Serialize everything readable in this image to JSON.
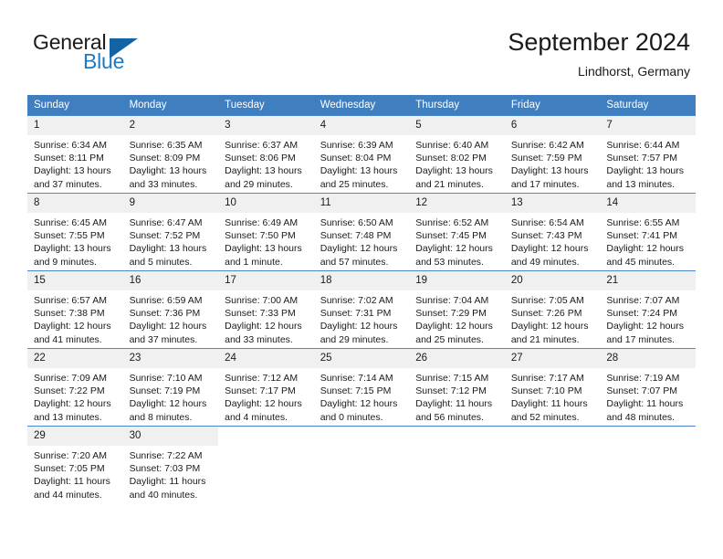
{
  "brand": {
    "name_part1": "General",
    "name_part2": "Blue",
    "triangle_color": "#1464a5",
    "blue_color": "#1f7ac4"
  },
  "header": {
    "title": "September 2024",
    "location": "Lindhorst, Germany",
    "header_bg": "#3f7fbf",
    "header_text_color": "#ffffff",
    "daynum_bg": "#f0f0f0",
    "row_border_color": "#4a86c8"
  },
  "weekdays": [
    {
      "label": "Sunday"
    },
    {
      "label": "Monday"
    },
    {
      "label": "Tuesday"
    },
    {
      "label": "Wednesday"
    },
    {
      "label": "Thursday"
    },
    {
      "label": "Friday"
    },
    {
      "label": "Saturday"
    }
  ],
  "weeks": [
    {
      "days": [
        {
          "num": "1",
          "sunrise": "Sunrise: 6:34 AM",
          "sunset": "Sunset: 8:11 PM",
          "daylight": "Daylight: 13 hours and 37 minutes."
        },
        {
          "num": "2",
          "sunrise": "Sunrise: 6:35 AM",
          "sunset": "Sunset: 8:09 PM",
          "daylight": "Daylight: 13 hours and 33 minutes."
        },
        {
          "num": "3",
          "sunrise": "Sunrise: 6:37 AM",
          "sunset": "Sunset: 8:06 PM",
          "daylight": "Daylight: 13 hours and 29 minutes."
        },
        {
          "num": "4",
          "sunrise": "Sunrise: 6:39 AM",
          "sunset": "Sunset: 8:04 PM",
          "daylight": "Daylight: 13 hours and 25 minutes."
        },
        {
          "num": "5",
          "sunrise": "Sunrise: 6:40 AM",
          "sunset": "Sunset: 8:02 PM",
          "daylight": "Daylight: 13 hours and 21 minutes."
        },
        {
          "num": "6",
          "sunrise": "Sunrise: 6:42 AM",
          "sunset": "Sunset: 7:59 PM",
          "daylight": "Daylight: 13 hours and 17 minutes."
        },
        {
          "num": "7",
          "sunrise": "Sunrise: 6:44 AM",
          "sunset": "Sunset: 7:57 PM",
          "daylight": "Daylight: 13 hours and 13 minutes."
        }
      ]
    },
    {
      "days": [
        {
          "num": "8",
          "sunrise": "Sunrise: 6:45 AM",
          "sunset": "Sunset: 7:55 PM",
          "daylight": "Daylight: 13 hours and 9 minutes."
        },
        {
          "num": "9",
          "sunrise": "Sunrise: 6:47 AM",
          "sunset": "Sunset: 7:52 PM",
          "daylight": "Daylight: 13 hours and 5 minutes."
        },
        {
          "num": "10",
          "sunrise": "Sunrise: 6:49 AM",
          "sunset": "Sunset: 7:50 PM",
          "daylight": "Daylight: 13 hours and 1 minute."
        },
        {
          "num": "11",
          "sunrise": "Sunrise: 6:50 AM",
          "sunset": "Sunset: 7:48 PM",
          "daylight": "Daylight: 12 hours and 57 minutes."
        },
        {
          "num": "12",
          "sunrise": "Sunrise: 6:52 AM",
          "sunset": "Sunset: 7:45 PM",
          "daylight": "Daylight: 12 hours and 53 minutes."
        },
        {
          "num": "13",
          "sunrise": "Sunrise: 6:54 AM",
          "sunset": "Sunset: 7:43 PM",
          "daylight": "Daylight: 12 hours and 49 minutes."
        },
        {
          "num": "14",
          "sunrise": "Sunrise: 6:55 AM",
          "sunset": "Sunset: 7:41 PM",
          "daylight": "Daylight: 12 hours and 45 minutes."
        }
      ]
    },
    {
      "days": [
        {
          "num": "15",
          "sunrise": "Sunrise: 6:57 AM",
          "sunset": "Sunset: 7:38 PM",
          "daylight": "Daylight: 12 hours and 41 minutes."
        },
        {
          "num": "16",
          "sunrise": "Sunrise: 6:59 AM",
          "sunset": "Sunset: 7:36 PM",
          "daylight": "Daylight: 12 hours and 37 minutes."
        },
        {
          "num": "17",
          "sunrise": "Sunrise: 7:00 AM",
          "sunset": "Sunset: 7:33 PM",
          "daylight": "Daylight: 12 hours and 33 minutes."
        },
        {
          "num": "18",
          "sunrise": "Sunrise: 7:02 AM",
          "sunset": "Sunset: 7:31 PM",
          "daylight": "Daylight: 12 hours and 29 minutes."
        },
        {
          "num": "19",
          "sunrise": "Sunrise: 7:04 AM",
          "sunset": "Sunset: 7:29 PM",
          "daylight": "Daylight: 12 hours and 25 minutes."
        },
        {
          "num": "20",
          "sunrise": "Sunrise: 7:05 AM",
          "sunset": "Sunset: 7:26 PM",
          "daylight": "Daylight: 12 hours and 21 minutes."
        },
        {
          "num": "21",
          "sunrise": "Sunrise: 7:07 AM",
          "sunset": "Sunset: 7:24 PM",
          "daylight": "Daylight: 12 hours and 17 minutes."
        }
      ]
    },
    {
      "days": [
        {
          "num": "22",
          "sunrise": "Sunrise: 7:09 AM",
          "sunset": "Sunset: 7:22 PM",
          "daylight": "Daylight: 12 hours and 13 minutes."
        },
        {
          "num": "23",
          "sunrise": "Sunrise: 7:10 AM",
          "sunset": "Sunset: 7:19 PM",
          "daylight": "Daylight: 12 hours and 8 minutes."
        },
        {
          "num": "24",
          "sunrise": "Sunrise: 7:12 AM",
          "sunset": "Sunset: 7:17 PM",
          "daylight": "Daylight: 12 hours and 4 minutes."
        },
        {
          "num": "25",
          "sunrise": "Sunrise: 7:14 AM",
          "sunset": "Sunset: 7:15 PM",
          "daylight": "Daylight: 12 hours and 0 minutes."
        },
        {
          "num": "26",
          "sunrise": "Sunrise: 7:15 AM",
          "sunset": "Sunset: 7:12 PM",
          "daylight": "Daylight: 11 hours and 56 minutes."
        },
        {
          "num": "27",
          "sunrise": "Sunrise: 7:17 AM",
          "sunset": "Sunset: 7:10 PM",
          "daylight": "Daylight: 11 hours and 52 minutes."
        },
        {
          "num": "28",
          "sunrise": "Sunrise: 7:19 AM",
          "sunset": "Sunset: 7:07 PM",
          "daylight": "Daylight: 11 hours and 48 minutes."
        }
      ]
    },
    {
      "days": [
        {
          "num": "29",
          "sunrise": "Sunrise: 7:20 AM",
          "sunset": "Sunset: 7:05 PM",
          "daylight": "Daylight: 11 hours and 44 minutes."
        },
        {
          "num": "30",
          "sunrise": "Sunrise: 7:22 AM",
          "sunset": "Sunset: 7:03 PM",
          "daylight": "Daylight: 11 hours and 40 minutes."
        },
        {
          "num": "",
          "sunrise": "",
          "sunset": "",
          "daylight": ""
        },
        {
          "num": "",
          "sunrise": "",
          "sunset": "",
          "daylight": ""
        },
        {
          "num": "",
          "sunrise": "",
          "sunset": "",
          "daylight": ""
        },
        {
          "num": "",
          "sunrise": "",
          "sunset": "",
          "daylight": ""
        },
        {
          "num": "",
          "sunrise": "",
          "sunset": "",
          "daylight": ""
        }
      ]
    }
  ]
}
